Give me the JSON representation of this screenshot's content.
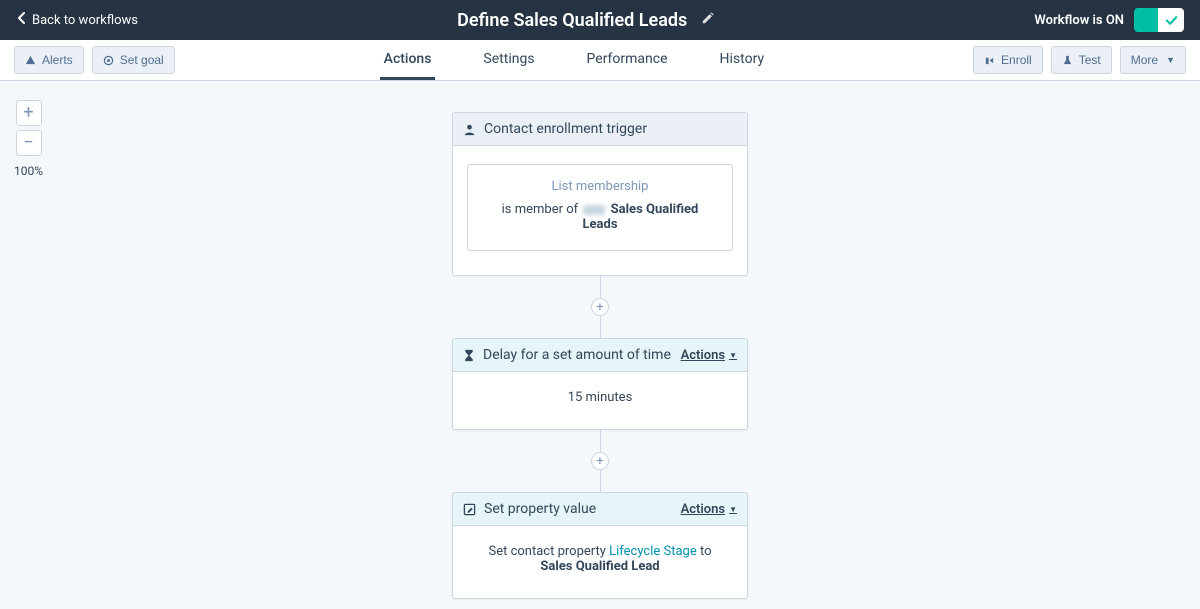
{
  "header": {
    "back_label": "Back to workflows",
    "title": "Define Sales Qualified Leads",
    "status_label": "Workflow is ON"
  },
  "toolbar": {
    "alerts_label": "Alerts",
    "set_goal_label": "Set goal",
    "enroll_label": "Enroll",
    "test_label": "Test",
    "more_label": "More"
  },
  "tabs": {
    "actions": "Actions",
    "settings": "Settings",
    "performance": "Performance",
    "history": "History"
  },
  "zoom": {
    "level_label": "100%"
  },
  "workflow": {
    "trigger": {
      "title": "Contact enrollment trigger",
      "sub_label": "List membership",
      "condition_prefix": "is member of",
      "list_name": "Sales Qualified Leads"
    },
    "delay": {
      "title": "Delay for a set amount of time",
      "actions_label": "Actions",
      "duration": "15 minutes"
    },
    "set_property": {
      "title": "Set property value",
      "actions_label": "Actions",
      "text_prefix": "Set contact property ",
      "property_name": "Lifecycle Stage",
      "text_mid": " to",
      "value": "Sales Qualified Lead"
    }
  }
}
